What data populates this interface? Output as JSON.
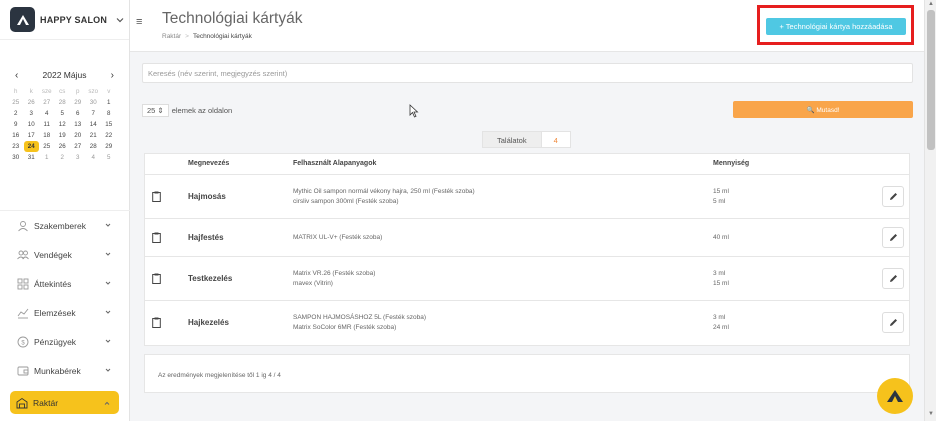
{
  "brand": {
    "name": "HAPPY SALON"
  },
  "calendar": {
    "month_label": "2022 Május",
    "weekdays": [
      "h",
      "k",
      "sze",
      "cs",
      "p",
      "szo",
      "v"
    ],
    "weeks": [
      [
        "25",
        "26",
        "27",
        "28",
        "29",
        "30",
        "1"
      ],
      [
        "2",
        "3",
        "4",
        "5",
        "6",
        "7",
        "8"
      ],
      [
        "9",
        "10",
        "11",
        "12",
        "13",
        "14",
        "15"
      ],
      [
        "16",
        "17",
        "18",
        "19",
        "20",
        "21",
        "22"
      ],
      [
        "23",
        "24",
        "25",
        "26",
        "27",
        "28",
        "29"
      ],
      [
        "30",
        "31",
        "1",
        "2",
        "3",
        "4",
        "5"
      ]
    ],
    "selected_day": "24"
  },
  "sidebar": {
    "items": [
      {
        "label": "Szakemberek",
        "icon": "user-icon"
      },
      {
        "label": "Vendégek",
        "icon": "users-icon"
      },
      {
        "label": "Áttekintés",
        "icon": "grid-icon"
      },
      {
        "label": "Elemzések",
        "icon": "chart-icon"
      },
      {
        "label": "Pénzügyek",
        "icon": "money-icon"
      },
      {
        "label": "Munkabérek",
        "icon": "wallet-icon"
      },
      {
        "label": "Raktár",
        "icon": "warehouse-icon",
        "active": true
      }
    ]
  },
  "header": {
    "title": "Technológiai kártyák",
    "breadcrumb": [
      "Raktár",
      "Technológiai kártyák"
    ],
    "add_button": "+ Technológiai kártya hozzáadása"
  },
  "search": {
    "placeholder": "Keresés (név szerint, megjegyzés szerint)"
  },
  "pagination": {
    "per_page_value": "25",
    "per_page_label": "elemek az oldalon"
  },
  "show_button": "Mutasd!",
  "results": {
    "label": "Találatok",
    "count": "4"
  },
  "table": {
    "headers": [
      "Megnevezés",
      "Felhasznált Alapanyagok",
      "Mennyiség"
    ],
    "rows": [
      {
        "name": "Hajmosás",
        "materials": [
          "Mythic Oil sampon normál vékony hajra, 250 ml (Festék szoba)",
          "cirsliv sampon 300ml (Festék szoba)"
        ],
        "quantities": [
          "15 ml",
          "5 ml"
        ]
      },
      {
        "name": "Hajfestés",
        "materials": [
          "MATRIX UL-V+ (Festék szoba)"
        ],
        "quantities": [
          "40 ml"
        ]
      },
      {
        "name": "Testkezelés",
        "materials": [
          "Matrix VR.26 (Festék szoba)",
          "mavex (Vitrin)"
        ],
        "quantities": [
          "3 ml",
          "15 ml"
        ]
      },
      {
        "name": "Hajkezelés",
        "materials": [
          "SAMPON HAJMOSÁSHOZ 5L (Festék szoba)",
          "Matrix SoColor 6MR (Festék szoba)"
        ],
        "quantities": [
          "3 ml",
          "24 ml"
        ]
      }
    ]
  },
  "footer": {
    "summary": "Az eredmények megjelenítése től 1 ig 4 / 4"
  },
  "colors": {
    "accent": "#f6c21c",
    "primary_button": "#4fc8e3",
    "show_button": "#f9a54a",
    "highlight_border": "#e61e1e"
  }
}
